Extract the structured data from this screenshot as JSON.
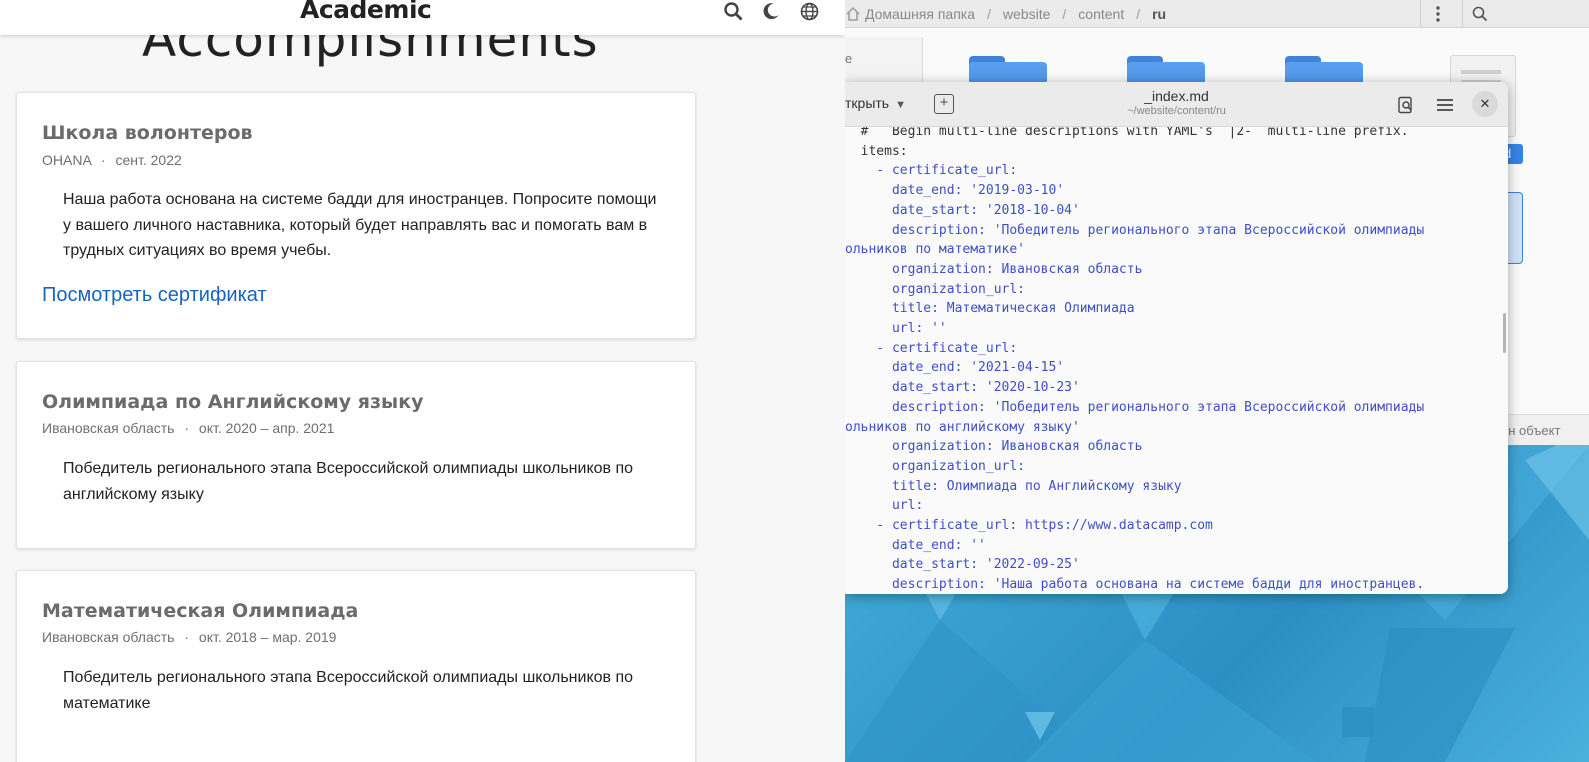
{
  "browser": {
    "brand": "Academic",
    "page_heading": "Accomplishments",
    "cards": [
      {
        "title": "Школа волонтеров",
        "organization": "OHANA",
        "date": "сент. 2022",
        "description": "Наша работа основана на системе бадди для иностранцев. Попросите помощи у вашего личного наставника, который будет направлять вас и помогать вам в трудных ситуациях во время учебы.",
        "link": "Посмотреть сертификат"
      },
      {
        "title": "Олимпиада по Английскому языку",
        "organization": "Ивановская область",
        "date": "окт. 2020 – апр. 2021",
        "description": "Победитель регионального этапа Всероссийской олимпиады школьников по английскому языку"
      },
      {
        "title": "Математическая Олимпиада",
        "organization": "Ивановская область",
        "date": "окт. 2018 – мар. 2019",
        "description": "Победитель регионального этапа Всероссийской олимпиады школьников по математике"
      }
    ],
    "meta_separator": "·",
    "icons": [
      "search-icon",
      "moon-icon",
      "globe-icon"
    ]
  },
  "file_manager": {
    "breadcrumb": [
      "Домашняя папка",
      "website",
      "content",
      "ru"
    ],
    "sidebar_fragment": "е",
    "status_fragment": "ен объект",
    "selected_fragment": "d",
    "icons": [
      "home-icon",
      "more-vertical-icon",
      "search-icon",
      "folder-icon",
      "document-icon"
    ]
  },
  "editor": {
    "open_label": "ткрыть",
    "title": "_index.md",
    "subtitle": "~/website/content/ru",
    "code_lines": [
      "  #   Begin multi-line descriptions with YAML's `|2-` multi-line prefix.",
      "  items:",
      "    - certificate_url:",
      "      date_end: '2019-03-10'",
      "      date_start: '2018-10-04'",
      "      description: 'Победитель регионального этапа Всероссийской олимпиады",
      "ольников по математике'",
      "      organization: Ивановская область",
      "      organization_url:",
      "      title: Математическая Олимпиада",
      "      url: ''",
      "    - certificate_url:",
      "      date_end: '2021-04-15'",
      "      date_start: '2020-10-23'",
      "      description: 'Победитель регионального этапа Всероссийской олимпиады",
      "ольников по английскому языку'",
      "      organization: Ивановская область",
      "      organization_url:",
      "      title: Олимпиада по Английскому языку",
      "      url:",
      "    - certificate_url: https://www.datacamp.com",
      "      date_end: ''",
      "      date_start: '2022-09-25'",
      "      description: 'Наша работа основана на системе бадди для иностранцев."
    ],
    "icons": [
      "new-tab-icon",
      "search-doc-icon",
      "menu-icon",
      "close-icon"
    ]
  },
  "colors": {
    "link": "#1565c0",
    "code": "#3d4fc7",
    "folder": "#3d87dc",
    "desktop": "#3ea5d6"
  }
}
